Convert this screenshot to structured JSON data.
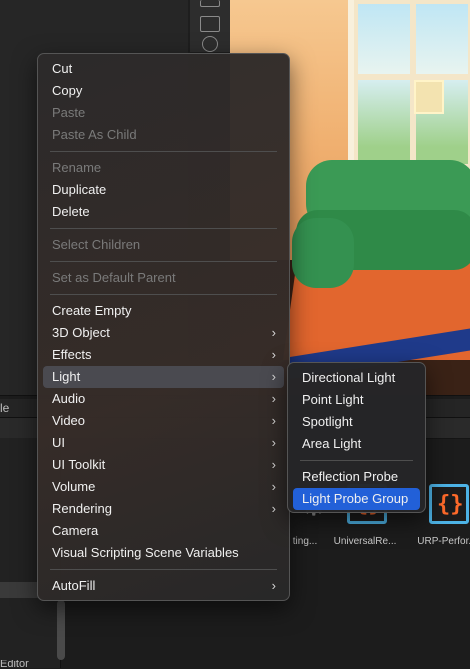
{
  "background": {
    "panel_tab_partial": "le",
    "editor_partial": "Editor",
    "assets": [
      {
        "name": "ting...",
        "icon": "gear-icon"
      },
      {
        "name": "UniversalRe...",
        "icon": "urp-script-icon"
      },
      {
        "name": "URP-Perfor...",
        "icon": "urp-script-icon"
      }
    ]
  },
  "context_menu": {
    "groups": [
      [
        {
          "label": "Cut",
          "enabled": true
        },
        {
          "label": "Copy",
          "enabled": true
        },
        {
          "label": "Paste",
          "enabled": false
        },
        {
          "label": "Paste As Child",
          "enabled": false
        }
      ],
      [
        {
          "label": "Rename",
          "enabled": false
        },
        {
          "label": "Duplicate",
          "enabled": true
        },
        {
          "label": "Delete",
          "enabled": true
        }
      ],
      [
        {
          "label": "Select Children",
          "enabled": false
        }
      ],
      [
        {
          "label": "Set as Default Parent",
          "enabled": false
        }
      ],
      [
        {
          "label": "Create Empty",
          "enabled": true
        },
        {
          "label": "3D Object",
          "enabled": true,
          "submenu": true
        },
        {
          "label": "Effects",
          "enabled": true,
          "submenu": true
        },
        {
          "label": "Light",
          "enabled": true,
          "submenu": true,
          "highlighted": true
        },
        {
          "label": "Audio",
          "enabled": true,
          "submenu": true
        },
        {
          "label": "Video",
          "enabled": true,
          "submenu": true
        },
        {
          "label": "UI",
          "enabled": true,
          "submenu": true
        },
        {
          "label": "UI Toolkit",
          "enabled": true,
          "submenu": true
        },
        {
          "label": "Volume",
          "enabled": true,
          "submenu": true
        },
        {
          "label": "Rendering",
          "enabled": true,
          "submenu": true
        },
        {
          "label": "Camera",
          "enabled": true
        },
        {
          "label": "Visual Scripting Scene Variables",
          "enabled": true
        }
      ],
      [
        {
          "label": "AutoFill",
          "enabled": true,
          "submenu": true
        }
      ]
    ],
    "submenu_arrow": "›"
  },
  "light_submenu": {
    "groups": [
      [
        {
          "label": "Directional Light"
        },
        {
          "label": "Point Light"
        },
        {
          "label": "Spotlight"
        },
        {
          "label": "Area Light"
        }
      ],
      [
        {
          "label": "Reflection Probe"
        },
        {
          "label": "Light Probe Group",
          "selected": true
        }
      ]
    ]
  },
  "colors": {
    "selected": "#2260d8",
    "hover": "#4a4a50",
    "disabled_text": "#7a7a7a",
    "enabled_text": "#f0f0f0"
  }
}
